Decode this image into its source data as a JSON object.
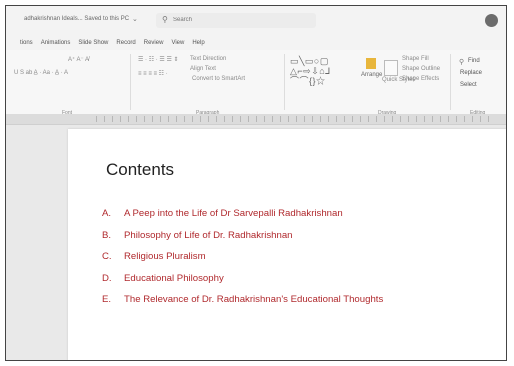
{
  "titlebar": {
    "doc_title": "adhakrishnan Ideals...  Saved to this PC",
    "search_placeholder": "Search"
  },
  "tabs": [
    "tions",
    "Animations",
    "Slide Show",
    "Record",
    "Review",
    "View",
    "Help"
  ],
  "ribbon": {
    "groups": [
      "Font",
      "Paragraph",
      "Drawing",
      "Editing"
    ],
    "shape_glyphs": "□\\\\□○□\n△⇁⇴⌂⅁{\n⌒⌒⌒{}☆",
    "arrange_label": "Arrange",
    "quick_styles_label": "Quick Styles",
    "shape_fill_label": "Shape Fill",
    "shape_outline_label": "Shape Outline",
    "shape_effects_label": "Shape Effects",
    "find_label": "Find",
    "replace_label": "Replace",
    "select_label": "Select",
    "text_direction_label": "Text Direction",
    "align_text_label": "Align Text",
    "convert_label": "Convert to SmartArt"
  },
  "document": {
    "heading": "Contents",
    "items": [
      {
        "letter": "A.",
        "text": "A Peep into the Life of Dr Sarvepalli Radhakrishnan"
      },
      {
        "letter": "B.",
        "text": "Philosophy of Life of Dr. Radhakrishnan"
      },
      {
        "letter": "C.",
        "text": "Religious Pluralism"
      },
      {
        "letter": "D.",
        "text": "Educational Philosophy"
      },
      {
        "letter": "E.",
        "text": "The Relevance of Dr. Radhakrishnan's Educational Thoughts"
      }
    ]
  },
  "colors": {
    "toc_item": "#b0292d",
    "heading": "#222222",
    "arrange_accent": "#e8b63c"
  }
}
